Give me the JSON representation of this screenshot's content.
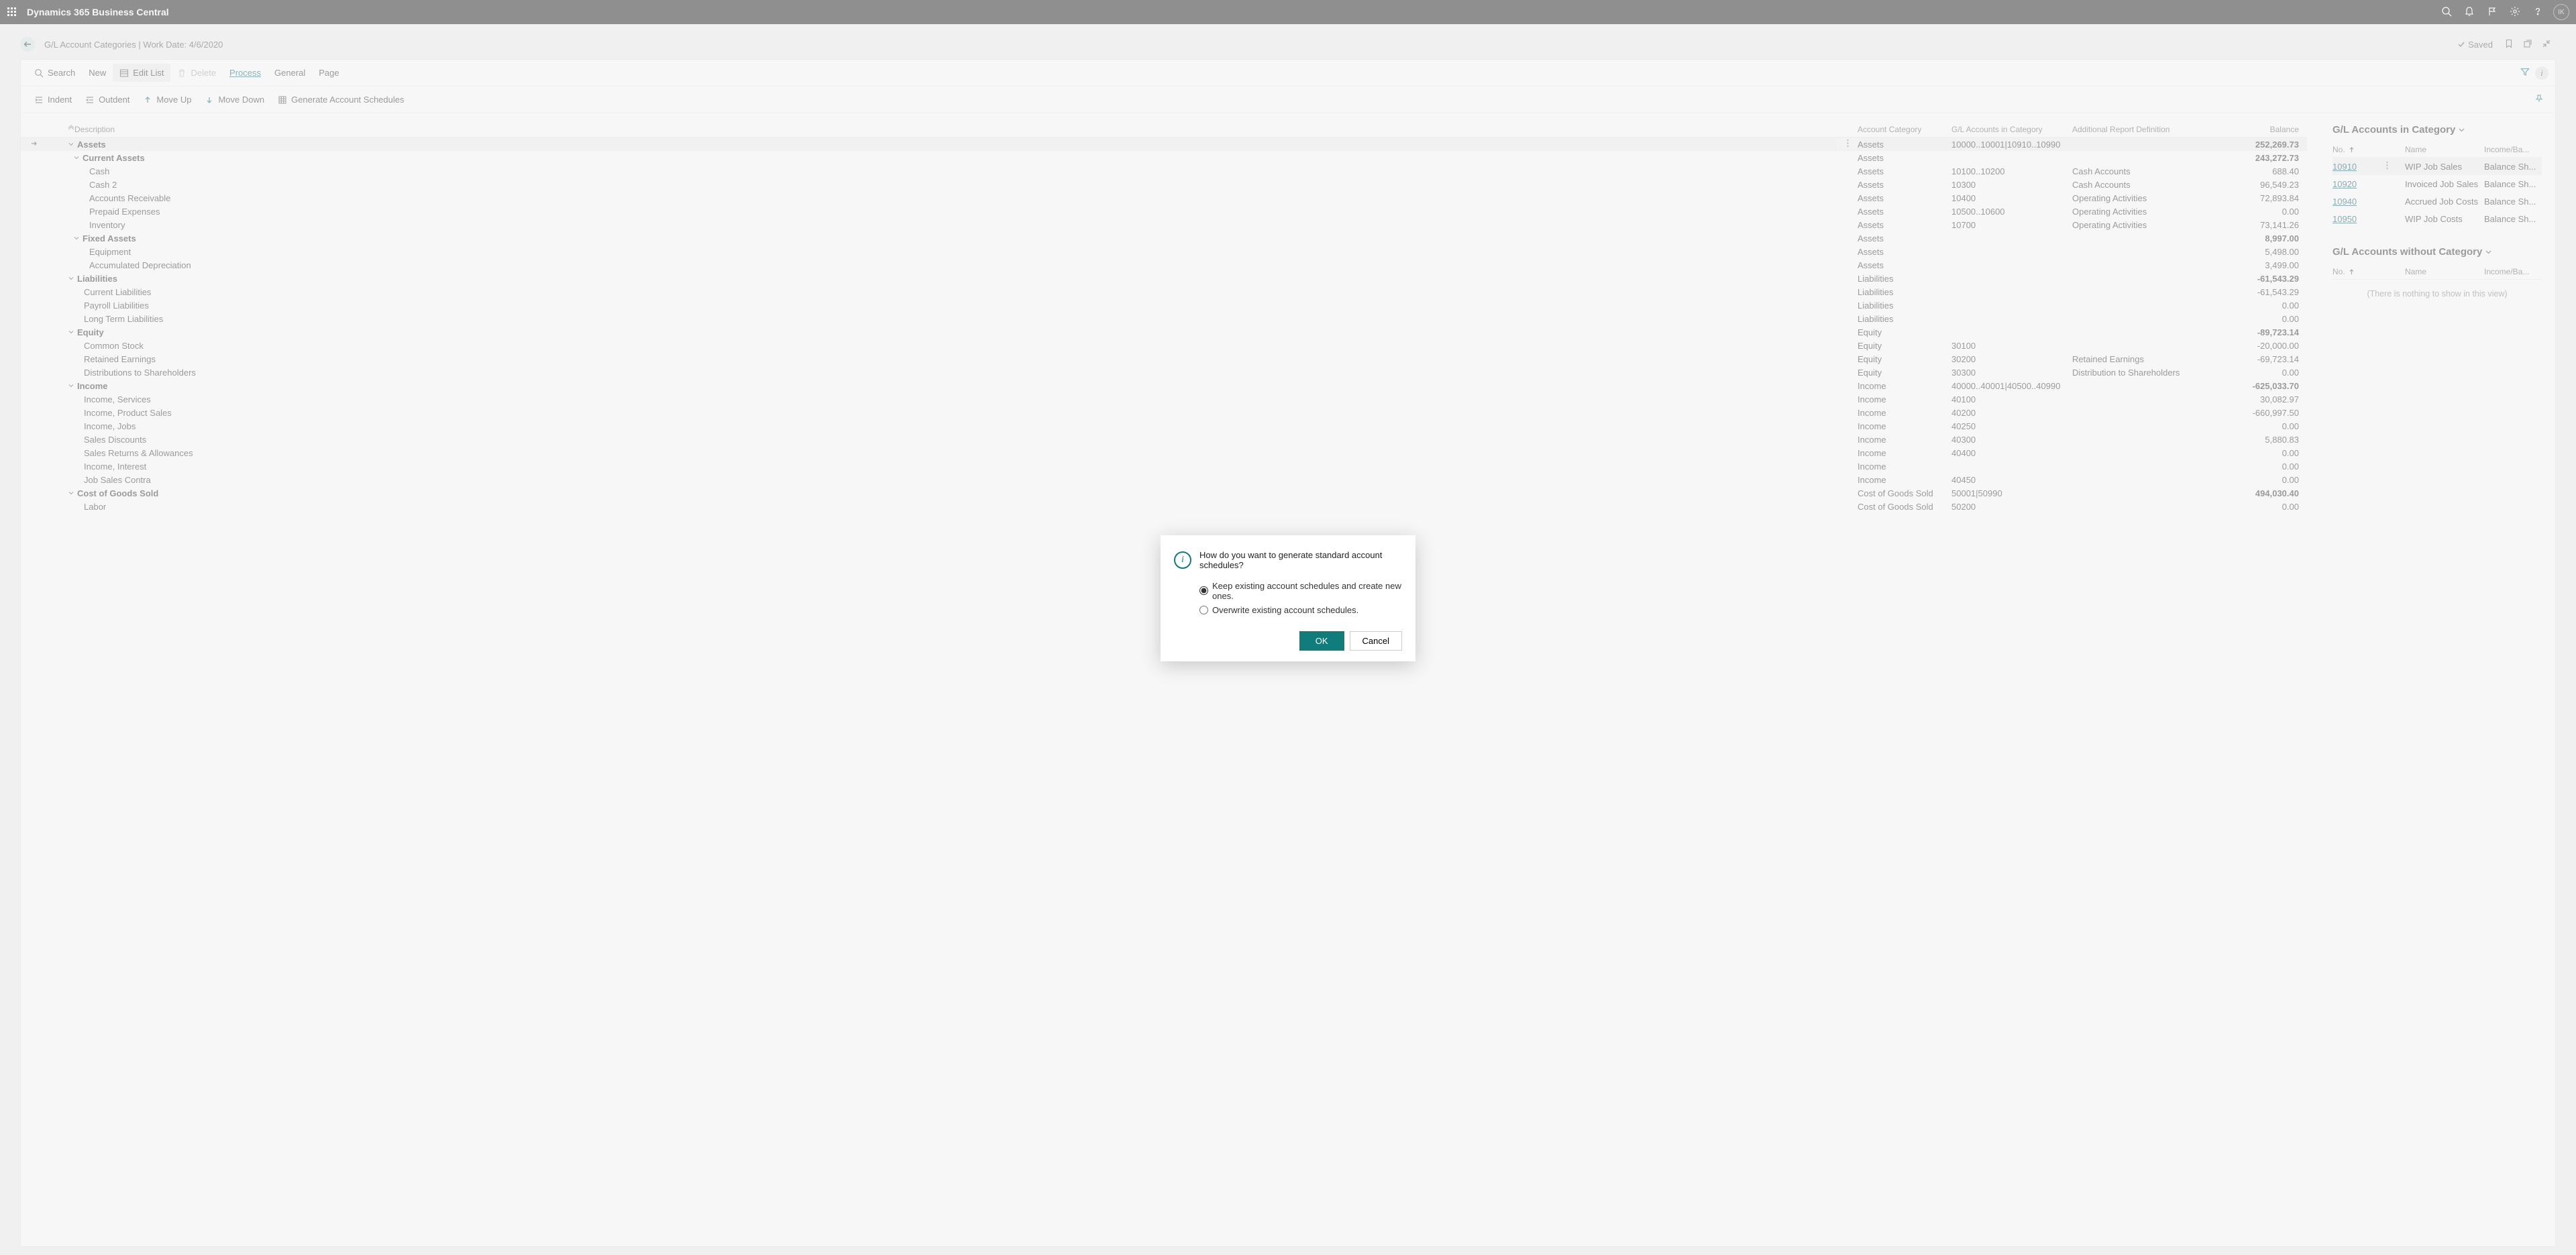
{
  "app": {
    "title": "Dynamics 365 Business Central",
    "avatar": "IK"
  },
  "page": {
    "breadcrumb": "G/L Account Categories | Work Date: 4/6/2020",
    "saved_label": "Saved"
  },
  "toolbar1": {
    "search": "Search",
    "new": "New",
    "edit_list": "Edit List",
    "delete": "Delete",
    "process": "Process",
    "general": "General",
    "page": "Page"
  },
  "toolbar2": {
    "indent": "Indent",
    "outdent": "Outdent",
    "move_up": "Move Up",
    "move_down": "Move Down",
    "generate": "Generate Account Schedules"
  },
  "grid": {
    "headers": {
      "description": "Description",
      "account_category": "Account Category",
      "gl_accounts_in_category": "G/L Accounts in Category",
      "additional_report_definition": "Additional Report Definition",
      "balance": "Balance"
    },
    "rows": [
      {
        "indent": 0,
        "caret": true,
        "desc": "Assets",
        "cat": "Assets",
        "gl": "10000..10001|10910..10990",
        "add": "",
        "bal": "252,269.73",
        "bold": true,
        "selected": true,
        "menu": true,
        "arrow": true
      },
      {
        "indent": 1,
        "caret": true,
        "desc": "Current Assets",
        "cat": "Assets",
        "gl": "",
        "add": "",
        "bal": "243,272.73",
        "bold": true
      },
      {
        "indent": 2,
        "caret": false,
        "desc": "Cash",
        "cat": "Assets",
        "gl": "10100..10200",
        "add": "Cash Accounts",
        "bal": "688.40"
      },
      {
        "indent": 2,
        "caret": false,
        "desc": "Cash 2",
        "cat": "Assets",
        "gl": "10300",
        "add": "Cash Accounts",
        "bal": "96,549.23"
      },
      {
        "indent": 2,
        "caret": false,
        "desc": "Accounts Receivable",
        "cat": "Assets",
        "gl": "10400",
        "add": "Operating Activities",
        "bal": "72,893.84"
      },
      {
        "indent": 2,
        "caret": false,
        "desc": "Prepaid Expenses",
        "cat": "Assets",
        "gl": "10500..10600",
        "add": "Operating Activities",
        "bal": "0.00"
      },
      {
        "indent": 2,
        "caret": false,
        "desc": "Inventory",
        "cat": "Assets",
        "gl": "10700",
        "add": "Operating Activities",
        "bal": "73,141.26"
      },
      {
        "indent": 1,
        "caret": true,
        "desc": "Fixed Assets",
        "cat": "Assets",
        "gl": "",
        "add": "",
        "bal": "8,997.00",
        "bold": true
      },
      {
        "indent": 2,
        "caret": false,
        "desc": "Equipment",
        "cat": "Assets",
        "gl": "",
        "add": "",
        "bal": "5,498.00"
      },
      {
        "indent": 2,
        "caret": false,
        "desc": "Accumulated Depreciation",
        "cat": "Assets",
        "gl": "",
        "add": "",
        "bal": "3,499.00"
      },
      {
        "indent": 0,
        "caret": true,
        "desc": "Liabilities",
        "cat": "Liabilities",
        "gl": "",
        "add": "",
        "bal": "-61,543.29",
        "bold": true
      },
      {
        "indent": 1,
        "caret": false,
        "desc": "Current Liabilities",
        "cat": "Liabilities",
        "gl": "",
        "add": "",
        "bal": "-61,543.29"
      },
      {
        "indent": 1,
        "caret": false,
        "desc": "Payroll Liabilities",
        "cat": "Liabilities",
        "gl": "",
        "add": "",
        "bal": "0.00"
      },
      {
        "indent": 1,
        "caret": false,
        "desc": "Long Term Liabilities",
        "cat": "Liabilities",
        "gl": "",
        "add": "",
        "bal": "0.00"
      },
      {
        "indent": 0,
        "caret": true,
        "desc": "Equity",
        "cat": "Equity",
        "gl": "",
        "add": "",
        "bal": "-89,723.14",
        "bold": true
      },
      {
        "indent": 1,
        "caret": false,
        "desc": "Common Stock",
        "cat": "Equity",
        "gl": "30100",
        "add": "",
        "bal": "-20,000.00"
      },
      {
        "indent": 1,
        "caret": false,
        "desc": "Retained Earnings",
        "cat": "Equity",
        "gl": "30200",
        "add": "Retained Earnings",
        "bal": "-69,723.14"
      },
      {
        "indent": 1,
        "caret": false,
        "desc": "Distributions to Shareholders",
        "cat": "Equity",
        "gl": "30300",
        "add": "Distribution to Shareholders",
        "bal": "0.00"
      },
      {
        "indent": 0,
        "caret": true,
        "desc": "Income",
        "cat": "Income",
        "gl": "40000..40001|40500..40990",
        "add": "",
        "bal": "-625,033.70",
        "bold": true
      },
      {
        "indent": 1,
        "caret": false,
        "desc": "Income, Services",
        "cat": "Income",
        "gl": "40100",
        "add": "",
        "bal": "30,082.97"
      },
      {
        "indent": 1,
        "caret": false,
        "desc": "Income, Product Sales",
        "cat": "Income",
        "gl": "40200",
        "add": "",
        "bal": "-660,997.50"
      },
      {
        "indent": 1,
        "caret": false,
        "desc": "Income, Jobs",
        "cat": "Income",
        "gl": "40250",
        "add": "",
        "bal": "0.00"
      },
      {
        "indent": 1,
        "caret": false,
        "desc": "Sales Discounts",
        "cat": "Income",
        "gl": "40300",
        "add": "",
        "bal": "5,880.83"
      },
      {
        "indent": 1,
        "caret": false,
        "desc": "Sales Returns & Allowances",
        "cat": "Income",
        "gl": "40400",
        "add": "",
        "bal": "0.00"
      },
      {
        "indent": 1,
        "caret": false,
        "desc": "Income, Interest",
        "cat": "Income",
        "gl": "",
        "add": "",
        "bal": "0.00"
      },
      {
        "indent": 1,
        "caret": false,
        "desc": "Job Sales Contra",
        "cat": "Income",
        "gl": "40450",
        "add": "",
        "bal": "0.00"
      },
      {
        "indent": 0,
        "caret": true,
        "desc": "Cost of Goods Sold",
        "cat": "Cost of Goods Sold",
        "gl": "50001|50990",
        "add": "",
        "bal": "494,030.40",
        "bold": true
      },
      {
        "indent": 1,
        "caret": false,
        "desc": "Labor",
        "cat": "Cost of Goods Sold",
        "gl": "50200",
        "add": "",
        "bal": "0.00"
      }
    ]
  },
  "side1": {
    "title": "G/L Accounts in Category",
    "headers": {
      "no": "No.",
      "name": "Name",
      "inc": "Income/Ba..."
    },
    "rows": [
      {
        "no": "10910",
        "name": "WIP Job Sales",
        "inc": "Balance Sh...",
        "selected": true,
        "menu": true
      },
      {
        "no": "10920",
        "name": "Invoiced Job Sales",
        "inc": "Balance Sh..."
      },
      {
        "no": "10940",
        "name": "Accrued Job Costs",
        "inc": "Balance Sh..."
      },
      {
        "no": "10950",
        "name": "WIP Job Costs",
        "inc": "Balance Sh..."
      }
    ]
  },
  "side2": {
    "title": "G/L Accounts without Category",
    "headers": {
      "no": "No.",
      "name": "Name",
      "inc": "Income/Ba..."
    },
    "empty": "(There is nothing to show in this view)"
  },
  "modal": {
    "question": "How do you want to generate standard account schedules?",
    "opt_keep": "Keep existing account schedules and create new ones.",
    "opt_overwrite": "Overwrite existing account schedules.",
    "ok": "OK",
    "cancel": "Cancel"
  }
}
